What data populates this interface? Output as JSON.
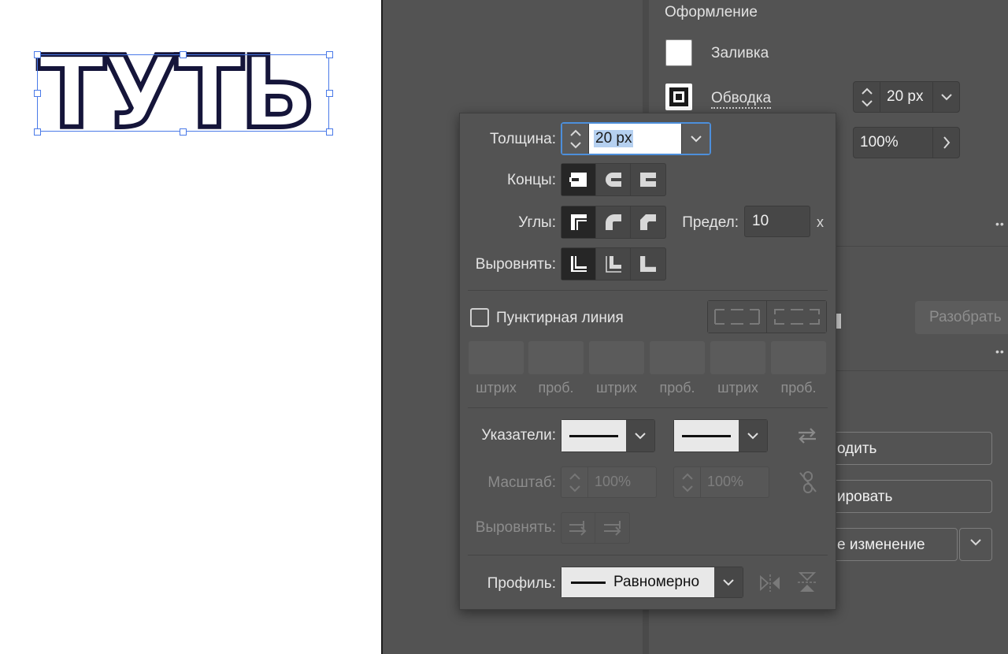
{
  "canvas": {
    "art_text": "ТУТЬ"
  },
  "properties": {
    "section_title": "Оформление",
    "fill_label": "Заливка",
    "stroke_label": "Обводка",
    "stroke_weight": "20 px",
    "opacity_value": "100%",
    "expand_button": "Разобрать",
    "button_1": "одить",
    "button_2": "ировать",
    "button_3": "е изменение"
  },
  "stroke_panel": {
    "weight_label": "Толщина:",
    "weight_value": "20 px",
    "caps_label": "Концы:",
    "corners_label": "Углы:",
    "limit_label": "Предел:",
    "limit_value": "10",
    "limit_unit": "x",
    "align_label": "Выровнять:",
    "dashed_label": "Пунктирная линия",
    "dash_labels": [
      "штрих",
      "проб.",
      "штрих",
      "проб.",
      "штрих",
      "проб."
    ],
    "arrowheads_label": "Указатели:",
    "scale_label": "Масштаб:",
    "scale_start": "100%",
    "scale_end": "100%",
    "arrow_align_label": "Выровнять:",
    "profile_label": "Профиль:",
    "profile_value": "Равномерно"
  },
  "colors": {
    "selection": "#4a7ae8",
    "focus": "#4d8fdb",
    "panel": "#535353"
  }
}
